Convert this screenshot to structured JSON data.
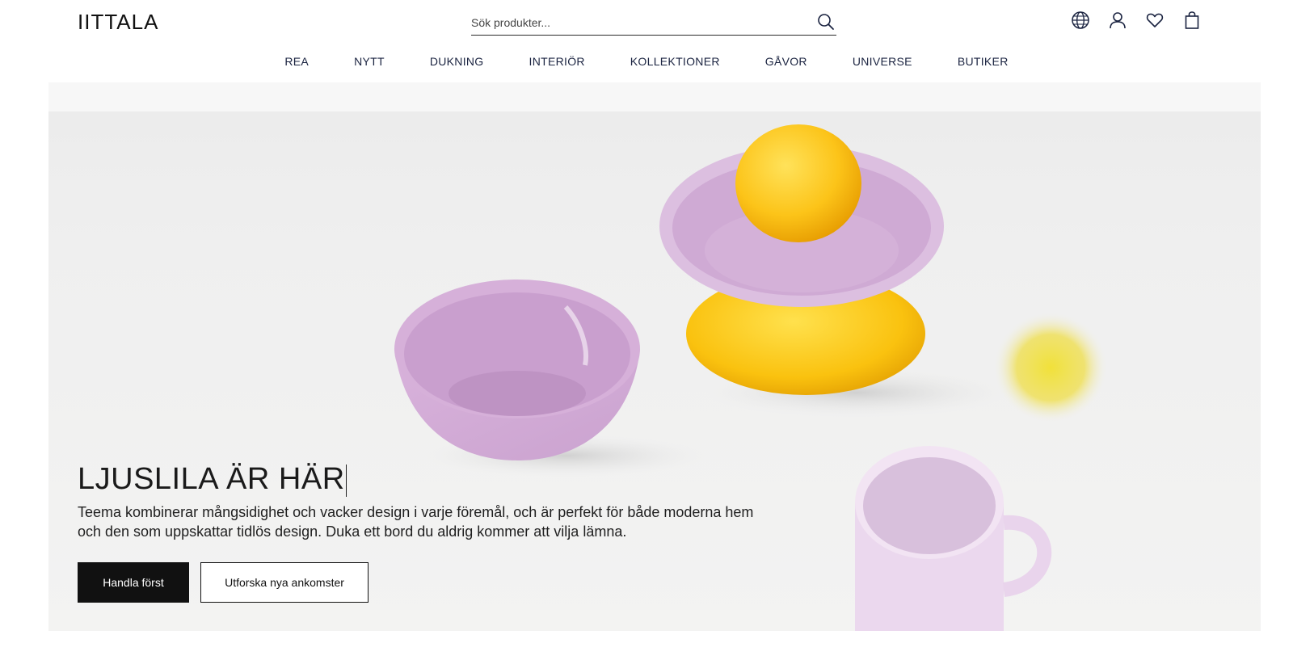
{
  "brand": {
    "logo": "IITTALA"
  },
  "search": {
    "placeholder": "Sök produkter..."
  },
  "header_icons": [
    "globe-icon",
    "user-icon",
    "heart-icon",
    "bag-icon"
  ],
  "nav": {
    "items": [
      "REA",
      "NYTT",
      "DUKNING",
      "INTERIÖR",
      "KOLLEKTIONER",
      "GÅVOR",
      "UNIVERSE",
      "BUTIKER"
    ]
  },
  "hero": {
    "title": "LJUSLILA ÄR HÄR",
    "description": "Teema kombinerar mångsidighet och vacker design i varje föremål, och är perfekt för både moderna hem och den som uppskattar tidlös design. Duka ett bord du aldrig kommer att vilja lämna.",
    "primary_button": "Handla först",
    "secondary_button": "Utforska nya ankomster"
  },
  "colors": {
    "accent_dark": "#111111",
    "nav_text": "#1a2340",
    "lilac": "#d9b8dc",
    "lemon": "#fcc419"
  }
}
